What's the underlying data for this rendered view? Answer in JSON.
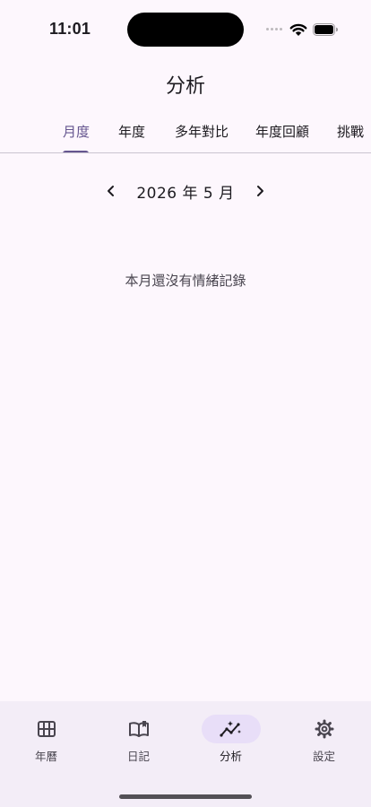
{
  "status_bar": {
    "time": "11:01"
  },
  "header": {
    "title": "分析"
  },
  "tabs": [
    {
      "label": "月度",
      "active": true
    },
    {
      "label": "年度"
    },
    {
      "label": "多年對比"
    },
    {
      "label": "年度回顧"
    },
    {
      "label": "挑戰"
    }
  ],
  "month_nav": {
    "label": "2026 年 5 月",
    "prev_icon": "chevron-left-icon",
    "next_icon": "chevron-right-icon"
  },
  "empty_state": {
    "message": "本月還沒有情緒記錄"
  },
  "bottom_nav": [
    {
      "label": "年曆",
      "icon": "grid-icon"
    },
    {
      "label": "日記",
      "icon": "book-icon"
    },
    {
      "label": "分析",
      "icon": "insights-icon",
      "active": true
    },
    {
      "label": "設定",
      "icon": "gear-icon"
    }
  ],
  "colors": {
    "accent": "#65558f",
    "background": "#fdf7fd",
    "nav_background": "#f3edf7",
    "active_pill": "#e8def8"
  }
}
